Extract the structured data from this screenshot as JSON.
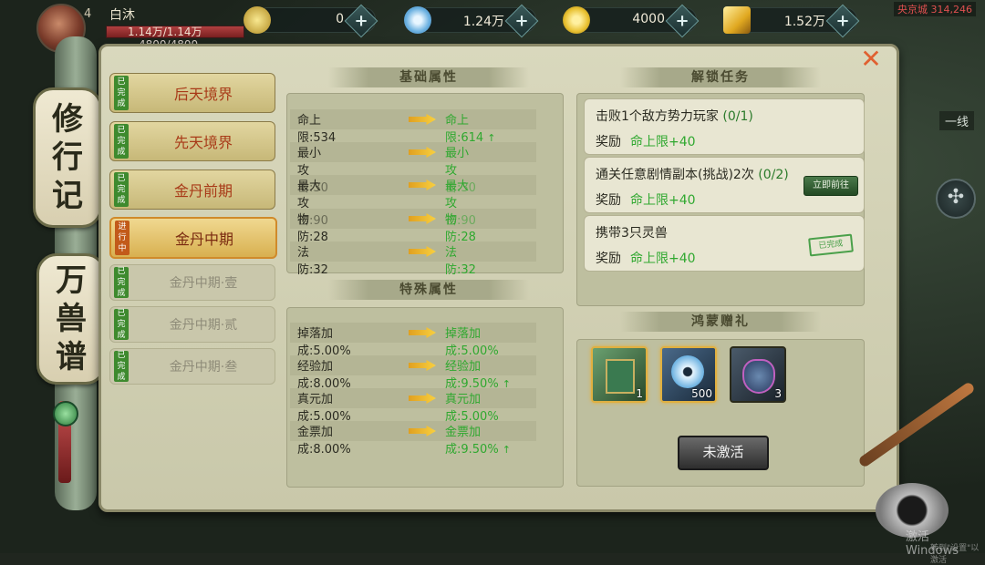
{
  "player": {
    "level": "4",
    "name": "白沐",
    "hp_line1": "1.14万/1.14万",
    "hp_line2": "4800/4800"
  },
  "resources": [
    {
      "icon": "jade-orb-icon",
      "value": "0",
      "color": "#d8c24a"
    },
    {
      "icon": "silver-coin-icon",
      "value": "1.24万",
      "color": "#8ac8f0"
    },
    {
      "icon": "gold-coin-icon",
      "value": "4000",
      "color": "#e8c030"
    },
    {
      "icon": "gold-ingot-icon",
      "value": "1.52万",
      "color": "#e0a820"
    }
  ],
  "minimap": {
    "location": "央京城 314,246"
  },
  "side": {
    "line": "一线"
  },
  "scroll_titles": {
    "top": [
      "修",
      "行",
      "记"
    ],
    "bottom": [
      "万",
      "兽",
      "谱"
    ]
  },
  "stages": [
    {
      "badge": [
        "已",
        "完",
        "成"
      ],
      "label": "后天境界",
      "state": "done"
    },
    {
      "badge": [
        "已",
        "完",
        "成"
      ],
      "label": "先天境界",
      "state": "done"
    },
    {
      "badge": [
        "已",
        "完",
        "成"
      ],
      "label": "金丹前期",
      "state": "done"
    },
    {
      "badge": [
        "进",
        "行",
        "中"
      ],
      "label": "金丹中期",
      "state": "current"
    },
    {
      "badge": [
        "已",
        "完",
        "成"
      ],
      "label": "金丹中期·壹",
      "state": "sub"
    },
    {
      "badge": [
        "已",
        "完",
        "成"
      ],
      "label": "金丹中期·贰",
      "state": "sub"
    },
    {
      "badge": [
        "已",
        "完",
        "成"
      ],
      "label": "金丹中期·叁",
      "state": "sub"
    }
  ],
  "basic_attrs": {
    "title": "基础属性",
    "rows": [
      {
        "cur": "命上限:534",
        "next": "命上限:614",
        "up": "↑"
      },
      {
        "cur": "最小攻击:30",
        "next": "最小攻击:30",
        "up": ""
      },
      {
        "cur": "最大攻击:90",
        "next": "最大攻击:90",
        "up": ""
      },
      {
        "cur": "物防:28",
        "next": "物防:28",
        "up": ""
      },
      {
        "cur": "法防:32",
        "next": "法防:32",
        "up": ""
      }
    ]
  },
  "special_attrs": {
    "title": "特殊属性",
    "rows": [
      {
        "cur": "掉落加成:5.00%",
        "next": "掉落加成:5.00%",
        "up": ""
      },
      {
        "cur": "经验加成:8.00%",
        "next": "经验加成:9.50%",
        "up": "↑"
      },
      {
        "cur": "真元加成:5.00%",
        "next": "真元加成:5.00%",
        "up": ""
      },
      {
        "cur": "金票加成:8.00%",
        "next": "金票加成:9.50%",
        "up": "↑"
      }
    ]
  },
  "unlock_tasks": {
    "title": "解锁任务",
    "reward_label": "奖励",
    "items": [
      {
        "title": "击败1个敌方势力玩家 ",
        "progress": "(0/1)",
        "reward": "命上限+40",
        "action": ""
      },
      {
        "title": "通关任意剧情副本(挑战)2次 ",
        "progress": "(0/2)",
        "reward": "命上限+40",
        "action": "立即前往"
      },
      {
        "title": "携带3只灵兽",
        "progress": "",
        "reward": "命上限+40",
        "action": "已完成"
      }
    ]
  },
  "gifts": {
    "title": "鸿蒙赠礼",
    "items": [
      {
        "icon": "skill-book-icon",
        "count": "1"
      },
      {
        "icon": "silver-coin-icon",
        "count": "500"
      },
      {
        "icon": "treasure-pouch-icon",
        "count": "3"
      }
    ],
    "button": "未激活"
  },
  "system": {
    "watermark": "激活 Windows",
    "watermark_sub": "转到\"设置\"以激活"
  },
  "colors": {
    "accent_green": "#2fa82f",
    "stage_text": "#a83a18",
    "badge_done": "#3e8a2e",
    "badge_current": "#c25a1a"
  }
}
